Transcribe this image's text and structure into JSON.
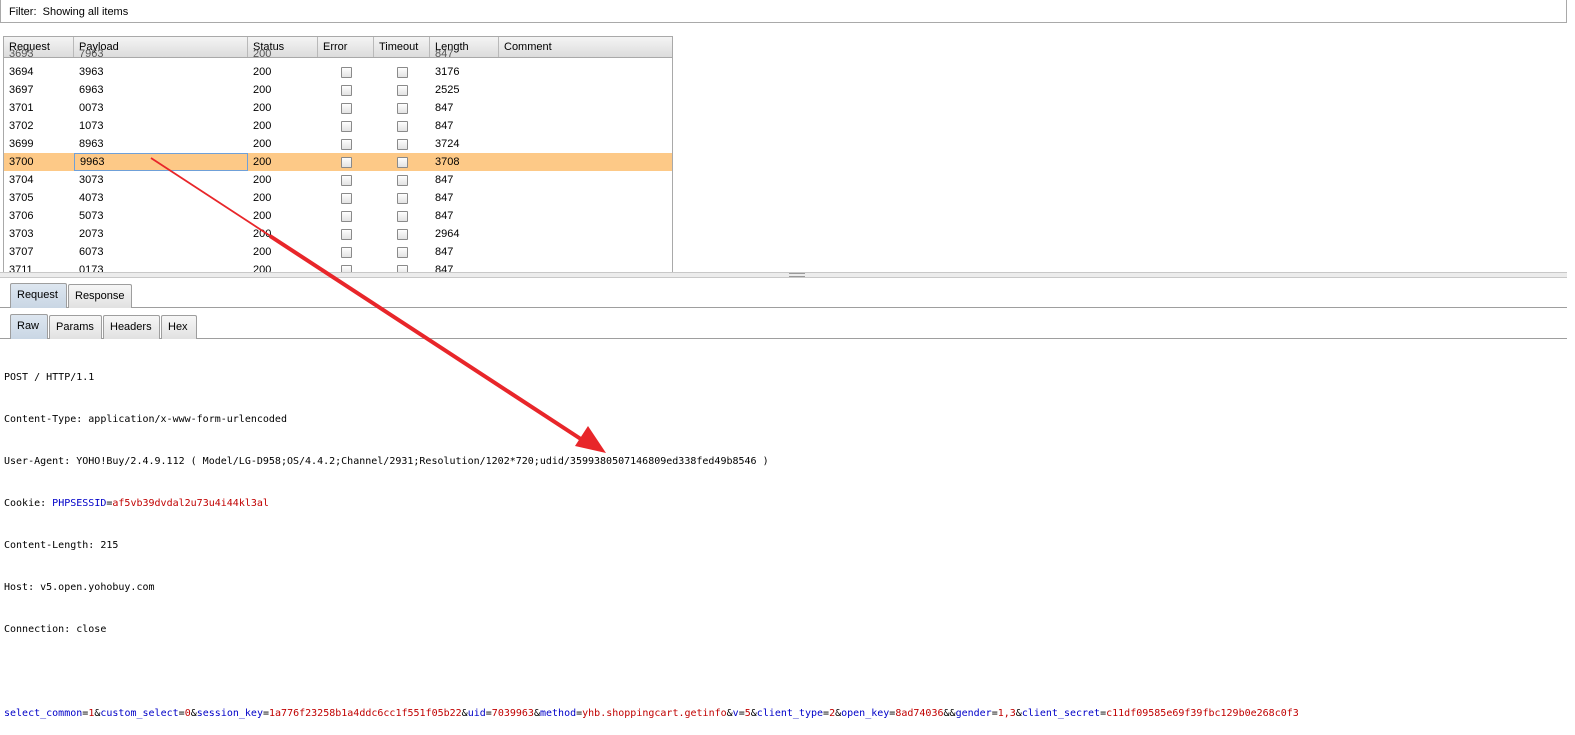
{
  "filter": {
    "label": "Filter:",
    "value": "Showing all items"
  },
  "table": {
    "columns": [
      "Request",
      "Payload",
      "Status",
      "Error",
      "Timeout",
      "Length",
      "Comment"
    ],
    "partial_row": {
      "request": "3693",
      "payload": "7963",
      "status": "200",
      "length": "847"
    },
    "rows": [
      {
        "request": "3694",
        "payload": "3963",
        "status": "200",
        "error": false,
        "timeout": false,
        "length": "3176",
        "comment": ""
      },
      {
        "request": "3697",
        "payload": "6963",
        "status": "200",
        "error": false,
        "timeout": false,
        "length": "2525",
        "comment": ""
      },
      {
        "request": "3701",
        "payload": "0073",
        "status": "200",
        "error": false,
        "timeout": false,
        "length": "847",
        "comment": ""
      },
      {
        "request": "3702",
        "payload": "1073",
        "status": "200",
        "error": false,
        "timeout": false,
        "length": "847",
        "comment": ""
      },
      {
        "request": "3699",
        "payload": "8963",
        "status": "200",
        "error": false,
        "timeout": false,
        "length": "3724",
        "comment": ""
      },
      {
        "request": "3700",
        "payload": "9963",
        "status": "200",
        "error": false,
        "timeout": false,
        "length": "3708",
        "comment": "",
        "selected": true
      },
      {
        "request": "3704",
        "payload": "3073",
        "status": "200",
        "error": false,
        "timeout": false,
        "length": "847",
        "comment": ""
      },
      {
        "request": "3705",
        "payload": "4073",
        "status": "200",
        "error": false,
        "timeout": false,
        "length": "847",
        "comment": ""
      },
      {
        "request": "3706",
        "payload": "5073",
        "status": "200",
        "error": false,
        "timeout": false,
        "length": "847",
        "comment": ""
      },
      {
        "request": "3703",
        "payload": "2073",
        "status": "200",
        "error": false,
        "timeout": false,
        "length": "2964",
        "comment": ""
      },
      {
        "request": "3707",
        "payload": "6073",
        "status": "200",
        "error": false,
        "timeout": false,
        "length": "847",
        "comment": ""
      },
      {
        "request": "3711",
        "payload": "0173",
        "status": "200",
        "error": false,
        "timeout": false,
        "length": "847",
        "comment": ""
      }
    ]
  },
  "tabs_top": [
    {
      "label": "Request",
      "active": true
    },
    {
      "label": "Response",
      "active": false
    }
  ],
  "tabs_sub": [
    {
      "label": "Raw",
      "active": true
    },
    {
      "label": "Params",
      "active": false
    },
    {
      "label": "Headers",
      "active": false
    },
    {
      "label": "Hex",
      "active": false
    }
  ],
  "request_raw": {
    "request_line": "POST / HTTP/1.1",
    "content_type": "Content-Type: application/x-www-form-urlencoded",
    "user_agent": "User-Agent: YOHO!Buy/2.4.9.112 ( Model/LG-D958;OS/4.4.2;Channel/2931;Resolution/1202*720;udid/3599380507146809ed338fed49b8546 )",
    "cookie_name": "Cookie: ",
    "cookie_key": "PHPSESSID",
    "cookie_value": "af5vb39dvdal2u73u4i44kl3al",
    "content_length": "Content-Length: 215",
    "host": "Host: v5.open.yohobuy.com",
    "connection": "Connection: close",
    "body_params": [
      {
        "key": "select_common",
        "value": "1"
      },
      {
        "key": "custom_select",
        "value": "0"
      },
      {
        "key": "session_key",
        "value": "1a776f23258b1a4ddc6cc1f551f05b22"
      },
      {
        "key": "uid",
        "value": "7039963"
      },
      {
        "key": "method",
        "value": "yhb.shoppingcart.getinfo"
      },
      {
        "key": "v",
        "value": "5"
      },
      {
        "key": "client_type",
        "value": "2"
      },
      {
        "key": "open_key",
        "value": "8ad74036"
      },
      {
        "key": "",
        "value": ""
      },
      {
        "key": "gender",
        "value": "1,3"
      },
      {
        "key": "client_secret",
        "value": "c11df09585e69f39fbc129b0e268c0f3"
      }
    ]
  },
  "colors": {
    "selected_row": "#fdc987",
    "param_key": "#0000c8",
    "param_value": "#c00000",
    "annotation_arrow": "#e8262a"
  }
}
